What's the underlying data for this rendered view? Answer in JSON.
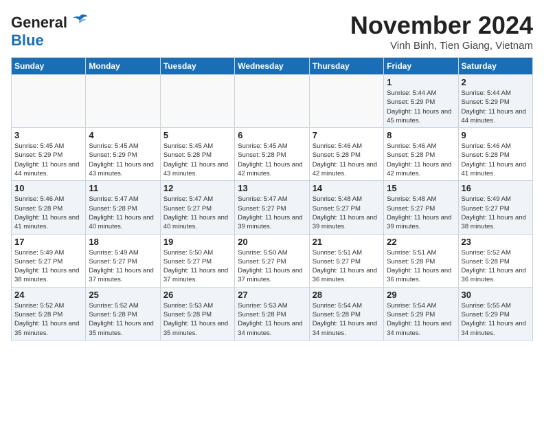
{
  "header": {
    "logo_general": "General",
    "logo_blue": "Blue",
    "month_title": "November 2024",
    "location": "Vinh Binh, Tien Giang, Vietnam"
  },
  "days_of_week": [
    "Sunday",
    "Monday",
    "Tuesday",
    "Wednesday",
    "Thursday",
    "Friday",
    "Saturday"
  ],
  "weeks": [
    [
      {
        "day": "",
        "detail": ""
      },
      {
        "day": "",
        "detail": ""
      },
      {
        "day": "",
        "detail": ""
      },
      {
        "day": "",
        "detail": ""
      },
      {
        "day": "",
        "detail": ""
      },
      {
        "day": "1",
        "detail": "Sunrise: 5:44 AM\nSunset: 5:29 PM\nDaylight: 11 hours and 45 minutes."
      },
      {
        "day": "2",
        "detail": "Sunrise: 5:44 AM\nSunset: 5:29 PM\nDaylight: 11 hours and 44 minutes."
      }
    ],
    [
      {
        "day": "3",
        "detail": "Sunrise: 5:45 AM\nSunset: 5:29 PM\nDaylight: 11 hours and 44 minutes."
      },
      {
        "day": "4",
        "detail": "Sunrise: 5:45 AM\nSunset: 5:29 PM\nDaylight: 11 hours and 43 minutes."
      },
      {
        "day": "5",
        "detail": "Sunrise: 5:45 AM\nSunset: 5:28 PM\nDaylight: 11 hours and 43 minutes."
      },
      {
        "day": "6",
        "detail": "Sunrise: 5:45 AM\nSunset: 5:28 PM\nDaylight: 11 hours and 42 minutes."
      },
      {
        "day": "7",
        "detail": "Sunrise: 5:46 AM\nSunset: 5:28 PM\nDaylight: 11 hours and 42 minutes."
      },
      {
        "day": "8",
        "detail": "Sunrise: 5:46 AM\nSunset: 5:28 PM\nDaylight: 11 hours and 42 minutes."
      },
      {
        "day": "9",
        "detail": "Sunrise: 5:46 AM\nSunset: 5:28 PM\nDaylight: 11 hours and 41 minutes."
      }
    ],
    [
      {
        "day": "10",
        "detail": "Sunrise: 5:46 AM\nSunset: 5:28 PM\nDaylight: 11 hours and 41 minutes."
      },
      {
        "day": "11",
        "detail": "Sunrise: 5:47 AM\nSunset: 5:28 PM\nDaylight: 11 hours and 40 minutes."
      },
      {
        "day": "12",
        "detail": "Sunrise: 5:47 AM\nSunset: 5:27 PM\nDaylight: 11 hours and 40 minutes."
      },
      {
        "day": "13",
        "detail": "Sunrise: 5:47 AM\nSunset: 5:27 PM\nDaylight: 11 hours and 39 minutes."
      },
      {
        "day": "14",
        "detail": "Sunrise: 5:48 AM\nSunset: 5:27 PM\nDaylight: 11 hours and 39 minutes."
      },
      {
        "day": "15",
        "detail": "Sunrise: 5:48 AM\nSunset: 5:27 PM\nDaylight: 11 hours and 39 minutes."
      },
      {
        "day": "16",
        "detail": "Sunrise: 5:49 AM\nSunset: 5:27 PM\nDaylight: 11 hours and 38 minutes."
      }
    ],
    [
      {
        "day": "17",
        "detail": "Sunrise: 5:49 AM\nSunset: 5:27 PM\nDaylight: 11 hours and 38 minutes."
      },
      {
        "day": "18",
        "detail": "Sunrise: 5:49 AM\nSunset: 5:27 PM\nDaylight: 11 hours and 37 minutes."
      },
      {
        "day": "19",
        "detail": "Sunrise: 5:50 AM\nSunset: 5:27 PM\nDaylight: 11 hours and 37 minutes."
      },
      {
        "day": "20",
        "detail": "Sunrise: 5:50 AM\nSunset: 5:27 PM\nDaylight: 11 hours and 37 minutes."
      },
      {
        "day": "21",
        "detail": "Sunrise: 5:51 AM\nSunset: 5:27 PM\nDaylight: 11 hours and 36 minutes."
      },
      {
        "day": "22",
        "detail": "Sunrise: 5:51 AM\nSunset: 5:28 PM\nDaylight: 11 hours and 36 minutes."
      },
      {
        "day": "23",
        "detail": "Sunrise: 5:52 AM\nSunset: 5:28 PM\nDaylight: 11 hours and 36 minutes."
      }
    ],
    [
      {
        "day": "24",
        "detail": "Sunrise: 5:52 AM\nSunset: 5:28 PM\nDaylight: 11 hours and 35 minutes."
      },
      {
        "day": "25",
        "detail": "Sunrise: 5:52 AM\nSunset: 5:28 PM\nDaylight: 11 hours and 35 minutes."
      },
      {
        "day": "26",
        "detail": "Sunrise: 5:53 AM\nSunset: 5:28 PM\nDaylight: 11 hours and 35 minutes."
      },
      {
        "day": "27",
        "detail": "Sunrise: 5:53 AM\nSunset: 5:28 PM\nDaylight: 11 hours and 34 minutes."
      },
      {
        "day": "28",
        "detail": "Sunrise: 5:54 AM\nSunset: 5:28 PM\nDaylight: 11 hours and 34 minutes."
      },
      {
        "day": "29",
        "detail": "Sunrise: 5:54 AM\nSunset: 5:29 PM\nDaylight: 11 hours and 34 minutes."
      },
      {
        "day": "30",
        "detail": "Sunrise: 5:55 AM\nSunset: 5:29 PM\nDaylight: 11 hours and 34 minutes."
      }
    ]
  ]
}
